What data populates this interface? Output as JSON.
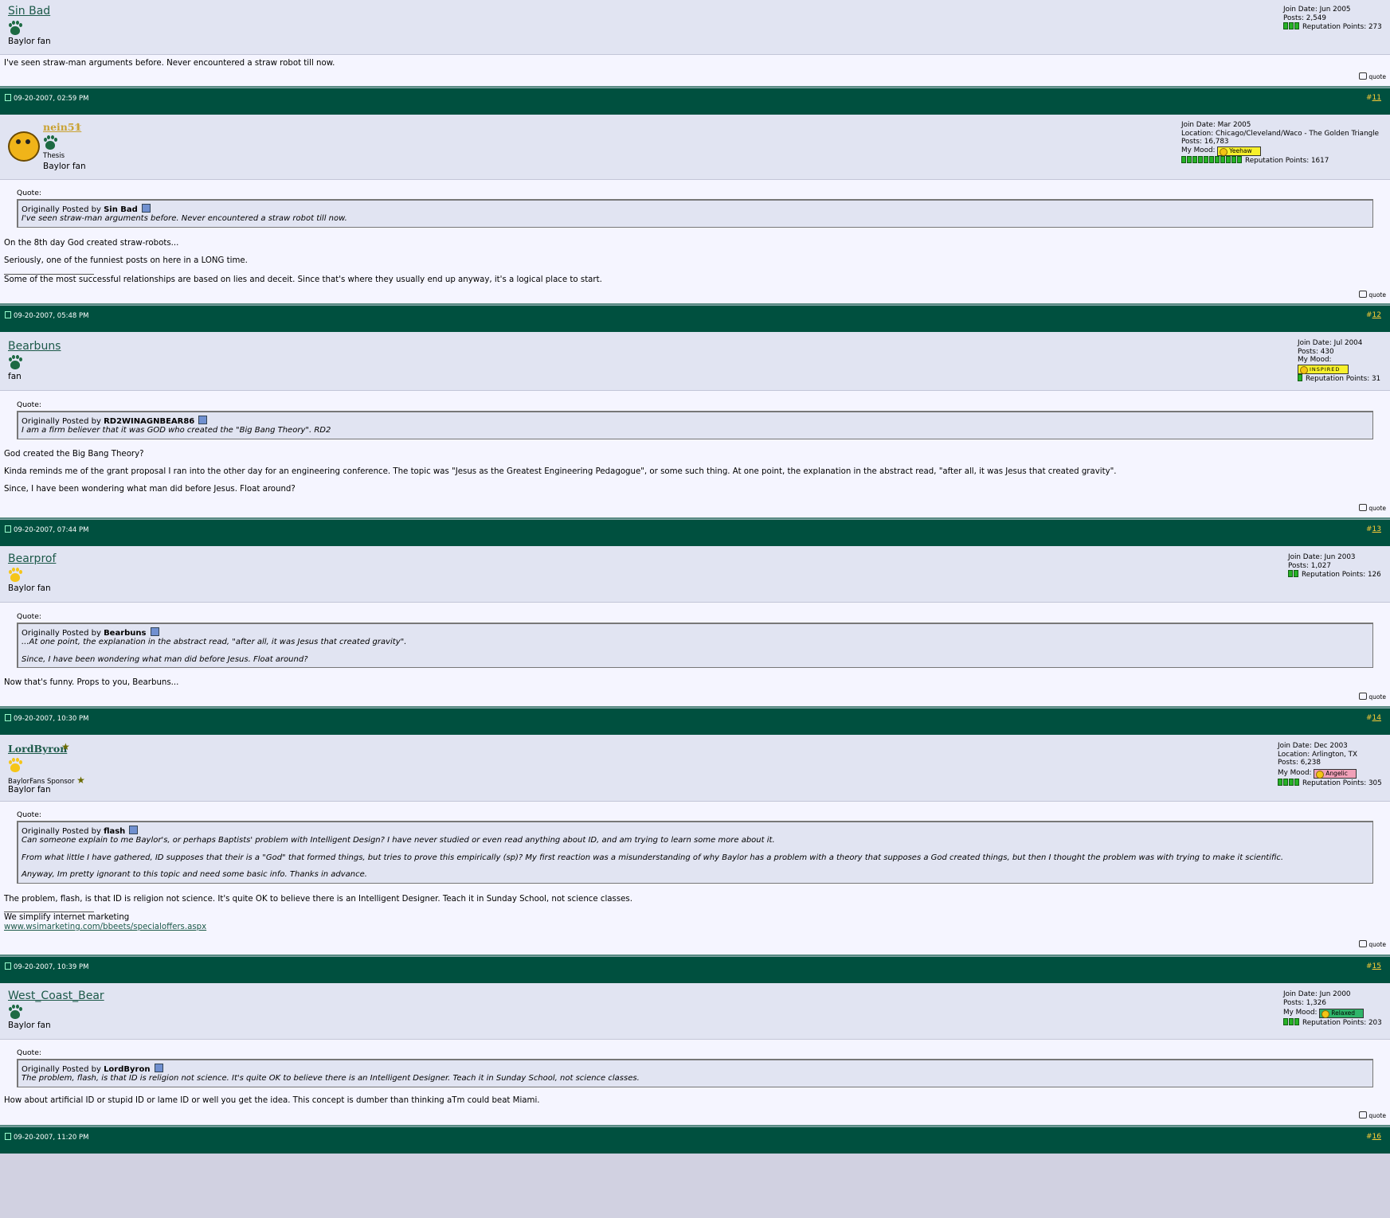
{
  "posts": [
    {
      "username": "Sin Bad",
      "user_title": "Baylor fan",
      "join_date": "Join Date:  Jun 2005",
      "posts": "Posts:  2,549",
      "reputation": "Reputation Points:  273",
      "body1": "I've seen straw-man arguments before. Never encountered a straw robot till now.",
      "quote_btn": "quote"
    },
    {
      "date": "09-20-2007, 02:59 PM",
      "num_prefix": "#",
      "num": "11",
      "username": "nein51",
      "rank": "Thesis",
      "user_title": "Baylor fan",
      "join_date": "Join Date:  Mar 2005",
      "location": "Location:  Chicago/Cleveland/Waco - The Golden Triangle",
      "posts": "Posts:  16,783",
      "mood_label": "My Mood:",
      "mood": "Yeehaw",
      "reputation": "Reputation Points:  1617",
      "quote_label": "Quote:",
      "quote_by": "Originally Posted by",
      "quote_author": "Sin Bad",
      "quote_text1": "I've seen straw-man arguments before. Never encountered a straw robot till now.",
      "body1": "On the 8th day God created straw-robots...",
      "body2": "Seriously, one of the funniest posts on here in a LONG time.",
      "sig1": "Some of the most successful relationships are based on lies and deceit. Since that's where they usually end up anyway, it's a logical place to start.",
      "quote_btn": "quote"
    },
    {
      "date": "09-20-2007, 05:48 PM",
      "num_prefix": "#",
      "num": "12",
      "username": "Bearbuns",
      "user_title": "fan",
      "join_date": "Join Date:  Jul 2004",
      "posts": "Posts:  430",
      "mood_label": "My Mood:",
      "mood": "INSPIRED",
      "reputation": "Reputation Points:  31",
      "quote_label": "Quote:",
      "quote_by": "Originally Posted by",
      "quote_author": "RD2WINAGNBEAR86",
      "quote_text1": "I am a firm believer that it was GOD who created the \"Big Bang Theory\". RD2",
      "body1": "God created the Big Bang Theory?",
      "body2": "Kinda reminds me of the grant proposal I ran into the other day for an engineering conference. The topic was \"Jesus as the Greatest Engineering Pedagogue\", or some such thing. At one point, the explanation in the abstract read, \"after all, it was Jesus that created gravity\".",
      "body3": "Since, I have been wondering what man did before Jesus. Float around?",
      "quote_btn": "quote"
    },
    {
      "date": "09-20-2007, 07:44 PM",
      "num_prefix": "#",
      "num": "13",
      "username": "Bearprof",
      "user_title": "Baylor fan",
      "join_date": "Join Date:  Jun 2003",
      "posts": "Posts:  1,027",
      "reputation": "Reputation Points:  126",
      "quote_label": "Quote:",
      "quote_by": "Originally Posted by",
      "quote_author": "Bearbuns",
      "quote_text1": "...At one point, the explanation in the abstract read, \"after all, it was Jesus that created gravity\".",
      "quote_text2": "Since, I have been wondering what man did before Jesus. Float around?",
      "body1": "Now that's funny. Props to you, Bearbuns...",
      "quote_btn": "quote"
    },
    {
      "date": "09-20-2007, 10:30 PM",
      "num_prefix": "#",
      "num": "14",
      "username": "LordByron",
      "rank": "BaylorFans Sponsor",
      "user_title": "Baylor fan",
      "join_date": "Join Date:  Dec 2003",
      "location": "Location:  Arlington, TX",
      "posts": "Posts:  6,238",
      "mood_label": "My Mood:",
      "mood": "Angelic",
      "reputation": "Reputation Points:  305",
      "quote_label": "Quote:",
      "quote_by": "Originally Posted by",
      "quote_author": "flash",
      "quote_text1": "Can someone explain to me Baylor's, or perhaps Baptists' problem with Intelligent Design? I have never studied or even read anything about ID, and am trying to learn some more about it.",
      "quote_text2": "From what little I have gathered, ID supposes that their is a \"God\" that formed things, but tries to prove this empirically (sp)? My first reaction was a misunderstanding of why Baylor has a problem with a theory that supposes a God created things, but then I thought the problem was with trying to make it scientific.",
      "quote_text3": "Anyway, Im pretty ignorant to this topic and need some basic info. Thanks in advance.",
      "body1": "The problem, flash, is that ID is religion not science. It's quite OK to believe there is an Intelligent Designer. Teach it in Sunday School, not science classes.",
      "sig1": "We simplify internet marketing",
      "sig_link": "www.wsimarketing.com/bbeets/specialoffers.aspx",
      "quote_btn": "quote"
    },
    {
      "date": "09-20-2007, 10:39 PM",
      "num_prefix": "#",
      "num": "15",
      "username": "West_Coast_Bear",
      "user_title": "Baylor fan",
      "join_date": "Join Date:  Jun 2000",
      "posts": "Posts:  1,326",
      "mood_label": "My Mood:",
      "mood": "Relaxed",
      "reputation": "Reputation Points:  203",
      "quote_label": "Quote:",
      "quote_by": "Originally Posted by",
      "quote_author": "LordByron",
      "quote_text1": "The problem, flash, is that ID is religion not science. It's quite OK to believe there is an Intelligent Designer. Teach it in Sunday School, not science classes.",
      "body1": "How about artificial ID or stupid ID or lame ID or well you get the idea. This concept is dumber than thinking aTm could beat Miami.",
      "quote_btn": "quote"
    },
    {
      "date": "09-20-2007, 11:20 PM",
      "num_prefix": "#",
      "num": "16"
    }
  ],
  "colors": {
    "header_bg": "#00503f",
    "userbar_bg": "#e1e4f2",
    "body_bg": "#f5f5ff",
    "link": "#1c5949",
    "post_number": "#ffce36",
    "rep_green": "#26b226"
  },
  "icons": [
    "bear-paw-icon",
    "post-icon",
    "view-post-icon",
    "quote-icon",
    "star-icon"
  ]
}
